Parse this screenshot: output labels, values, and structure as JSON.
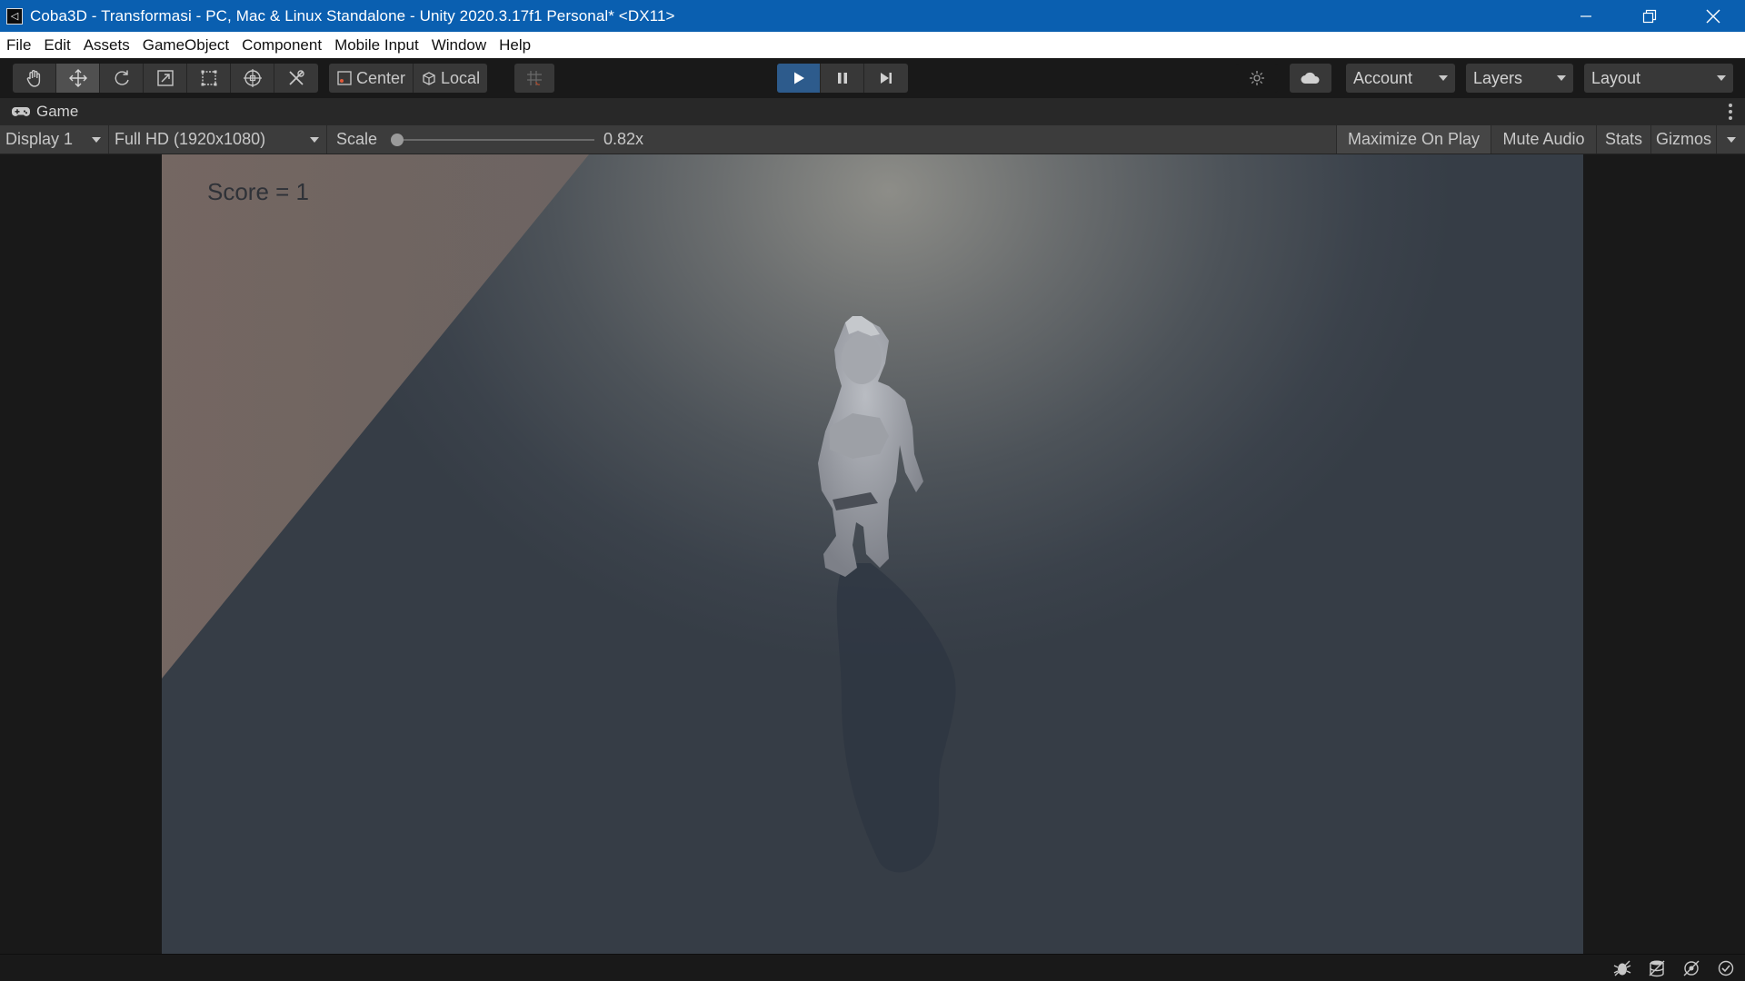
{
  "window": {
    "title": "Coba3D - Transformasi - PC, Mac & Linux Standalone - Unity 2020.3.17f1 Personal* <DX11>"
  },
  "menu": [
    "File",
    "Edit",
    "Assets",
    "GameObject",
    "Component",
    "Mobile Input",
    "Window",
    "Help"
  ],
  "toolbar": {
    "tools": [
      "hand-tool-icon",
      "move-tool-icon",
      "rotate-tool-icon",
      "scale-tool-icon",
      "rect-tool-icon",
      "transform-tool-icon",
      "custom-tool-icon"
    ],
    "pivot_mode": "Center",
    "pivot_rotation": "Local",
    "account_label": "Account",
    "layers_label": "Layers",
    "layout_label": "Layout"
  },
  "game_tab": {
    "label": "Game"
  },
  "game_toolbar": {
    "display": "Display 1",
    "resolution": "Full HD (1920x1080)",
    "scale_label": "Scale",
    "scale_value": "0.82x",
    "scale_fraction": 0.0,
    "maximize_on_play": "Maximize On Play",
    "mute_audio": "Mute Audio",
    "stats": "Stats",
    "gizmos": "Gizmos"
  },
  "game_view": {
    "score_text": "Score = 1"
  },
  "colors": {
    "title_bar": "#0a5fb0",
    "editor_bg": "#191919",
    "play_active": "#2d5b8c"
  }
}
